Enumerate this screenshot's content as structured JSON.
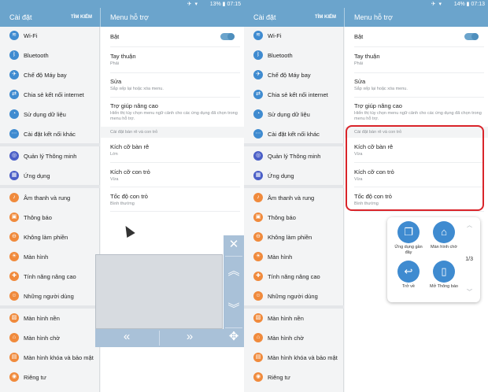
{
  "status": {
    "battery": "13%",
    "time": "07:15",
    "battery_right": "14%",
    "time_right": "07:13"
  },
  "appbar": {
    "settings": "Cài đặt",
    "search": "TÌM KIẾM",
    "menu_help": "Menu hỗ trợ"
  },
  "sidebar": {
    "items": [
      {
        "label": "Wi-Fi",
        "icon": "wifi-icon",
        "color": "#3f8bd0"
      },
      {
        "label": "Bluetooth",
        "icon": "bluetooth-icon",
        "color": "#3f8bd0"
      },
      {
        "label": "Chế độ Máy bay",
        "icon": "airplane-icon",
        "color": "#3f8bd0"
      },
      {
        "label": "Chia sẻ kết nối internet",
        "icon": "hotspot-icon",
        "color": "#3f8bd0"
      },
      {
        "label": "Sử dụng dữ liệu",
        "icon": "data-usage-icon",
        "color": "#3f8bd0"
      },
      {
        "label": "Cài đặt kết nối khác",
        "icon": "more-connections-icon",
        "color": "#3f8bd0"
      },
      {
        "label": "Quản lý Thông minh",
        "icon": "smart-manager-icon",
        "color": "#4b5fc7"
      },
      {
        "label": "Ứng dụng",
        "icon": "apps-icon",
        "color": "#4b5fc7"
      },
      {
        "label": "Âm thanh và rung",
        "icon": "sound-icon",
        "color": "#f08a3c"
      },
      {
        "label": "Thông báo",
        "icon": "notification-icon",
        "color": "#f08a3c"
      },
      {
        "label": "Không làm phiền",
        "icon": "do-not-disturb-icon",
        "color": "#f08a3c"
      },
      {
        "label": "Màn hình",
        "icon": "display-icon",
        "color": "#f08a3c"
      },
      {
        "label": "Tính năng nâng cao",
        "icon": "advanced-icon",
        "color": "#f08a3c"
      },
      {
        "label": "Những người dùng",
        "icon": "users-icon",
        "color": "#f08a3c"
      },
      {
        "label": "Màn hình nền",
        "icon": "wallpaper-icon",
        "color": "#f08a3c"
      },
      {
        "label": "Màn hình chờ",
        "icon": "home-screen-icon",
        "color": "#f08a3c"
      },
      {
        "label": "Màn hình khóa và bảo mật",
        "icon": "lock-icon",
        "color": "#f08a3c"
      },
      {
        "label": "Riêng tư",
        "icon": "privacy-icon",
        "color": "#f08a3c"
      }
    ]
  },
  "main": {
    "on": "Bật",
    "dominant_hand": {
      "title": "Tay thuận",
      "sub": "Phải"
    },
    "edit": {
      "title": "Sửa",
      "sub": "Sắp xếp lại hoặc xóa menu."
    },
    "assist_plus": {
      "title": "Trợ giúp nâng cao",
      "sub": "Hiển thị tùy chọn menu ngữ cảnh cho các ứng dụng đã chọn trong menu hỗ trợ."
    },
    "section": "Cài đặt bàn rê và con trỏ",
    "pad_size": {
      "title": "Kích cỡ bàn rê",
      "sub_left": "Lớn",
      "sub_right": "Vừa"
    },
    "pointer_size": {
      "title": "Kích cỡ con trỏ",
      "sub": "Vừa"
    },
    "pointer_speed": {
      "title": "Tốc độ con trỏ",
      "sub": "Bình thường"
    }
  },
  "assist_menu": {
    "recent": "Ứng dụng gần đây",
    "home": "Màn hình chờ",
    "back": "Trở về",
    "notifications": "Mở Thông báo",
    "page": "1/3"
  }
}
